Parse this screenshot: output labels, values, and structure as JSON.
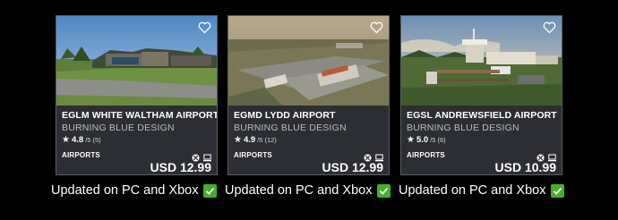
{
  "cards": [
    {
      "title": "EGLM WHITE WALTHAM AIRPORT",
      "developer": "BURNING BLUE DESIGN",
      "rating": "4.8",
      "rating_of": "/5",
      "rating_count": "(5)",
      "category": "AIRPORTS",
      "price": "USD 12.99",
      "caption": "Updated on PC and Xbox"
    },
    {
      "title": "EGMD LYDD AIRPORT",
      "developer": "BURNING BLUE DESIGN",
      "rating": "4.9",
      "rating_of": "/5",
      "rating_count": "(12)",
      "category": "AIRPORTS",
      "price": "USD 12.99",
      "caption": "Updated on PC and Xbox"
    },
    {
      "title": "EGSL ANDREWSFIELD AIRPORT",
      "developer": "BURNING BLUE DESIGN",
      "rating": "5.0",
      "rating_of": "/5",
      "rating_count": "(6)",
      "category": "AIRPORTS",
      "price": "USD 10.99",
      "caption": "Updated on PC and Xbox"
    }
  ],
  "icons": {
    "favorite": "heart-outline-icon",
    "star": "star-icon",
    "xbox": "xbox-icon",
    "pc": "pc-icon",
    "check": "check-mark-icon"
  },
  "colors": {
    "card_bg": "#2c2e33",
    "check_green": "#43b02a",
    "subtitle": "#b9bcc2"
  }
}
